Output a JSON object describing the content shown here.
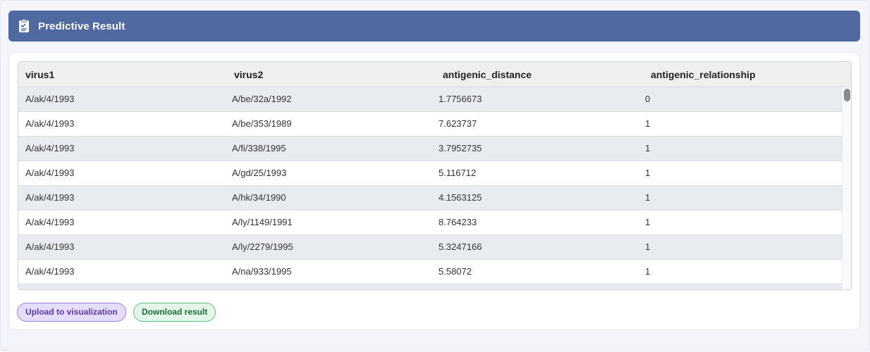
{
  "header": {
    "title": "Predictive Result",
    "icon": "clipboard-check-icon"
  },
  "table": {
    "columns": [
      "virus1",
      "virus2",
      "antigenic_distance",
      "antigenic_relationship"
    ],
    "rows": [
      [
        "A/ak/4/1993",
        "A/be/32a/1992",
        "1.7756673",
        "0"
      ],
      [
        "A/ak/4/1993",
        "A/be/353/1989",
        "7.623737",
        "1"
      ],
      [
        "A/ak/4/1993",
        "A/fi/338/1995",
        "3.7952735",
        "1"
      ],
      [
        "A/ak/4/1993",
        "A/gd/25/1993",
        "5.116712",
        "1"
      ],
      [
        "A/ak/4/1993",
        "A/hk/34/1990",
        "4.1563125",
        "1"
      ],
      [
        "A/ak/4/1993",
        "A/ly/1149/1991",
        "8.764233",
        "1"
      ],
      [
        "A/ak/4/1993",
        "A/ly/2279/1995",
        "5.3247166",
        "1"
      ],
      [
        "A/ak/4/1993",
        "A/na/933/1995",
        "5.58072",
        "1"
      ]
    ]
  },
  "actions": {
    "upload_label": "Upload to visualization",
    "download_label": "Download result"
  },
  "colors": {
    "header_bg": "#5069a0",
    "upload_bg": "#e6dcfb",
    "download_bg": "#e4f6ea"
  }
}
